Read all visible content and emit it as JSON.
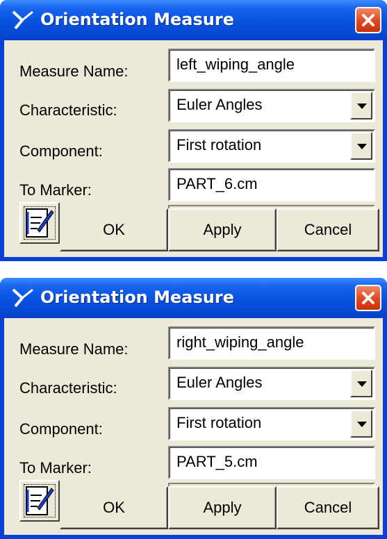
{
  "dialogs": [
    {
      "title": "Orientation Measure",
      "measure_name_label": "Measure Name:",
      "measure_name_value": "left_wiping_angle",
      "characteristic_label": "Characteristic:",
      "characteristic_value": "Euler Angles",
      "component_label": "Component:",
      "component_value": "First rotation",
      "to_marker_label": "To Marker:",
      "to_marker_value": "PART_6.cm",
      "ok_label": "OK",
      "apply_label": "Apply",
      "cancel_label": "Cancel"
    },
    {
      "title": "Orientation Measure",
      "measure_name_label": "Measure Name:",
      "measure_name_value": "right_wiping_angle",
      "characteristic_label": "Characteristic:",
      "characteristic_value": "Euler Angles",
      "component_label": "Component:",
      "component_value": "First rotation",
      "to_marker_label": "To Marker:",
      "to_marker_value": "PART_5.cm",
      "ok_label": "OK",
      "apply_label": "Apply",
      "cancel_label": "Cancel"
    }
  ],
  "icons": {
    "title_glyph": "adams-measure-icon",
    "close": "close-icon",
    "dropdown": "dropdown-arrow-icon",
    "edit": "edit-notepad-icon"
  },
  "colors": {
    "titlebar": "#0853e0",
    "close_button": "#e0461c",
    "dialog_face": "#ece9d8"
  }
}
